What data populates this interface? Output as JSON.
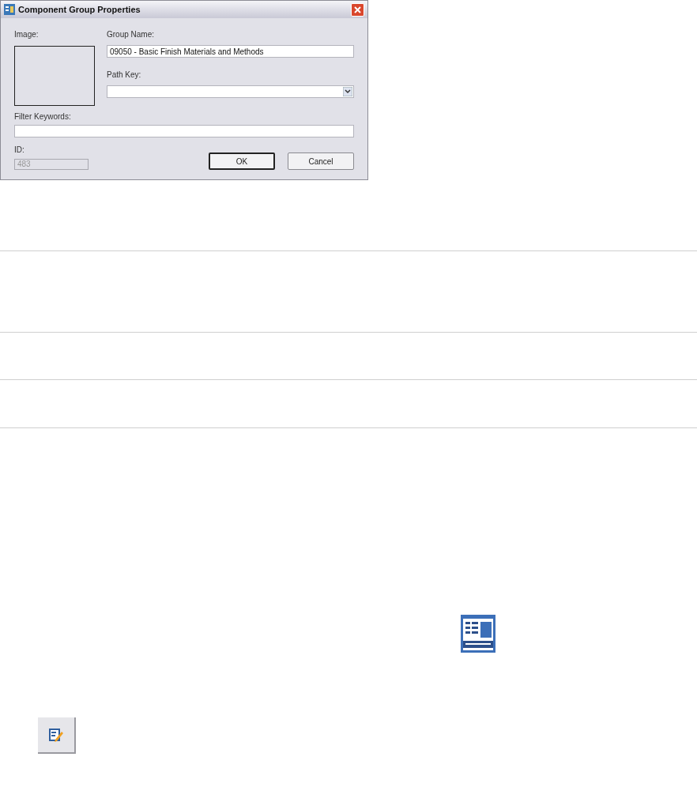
{
  "window": {
    "title": "Component Group Properties"
  },
  "image": {
    "label": "Image:"
  },
  "group_name": {
    "label": "Group Name:",
    "value": "09050 - Basic Finish Materials and Methods"
  },
  "path_key": {
    "label": "Path Key:"
  },
  "filter_keywords": {
    "label": "Filter Keywords:"
  },
  "id": {
    "label": "ID:",
    "value": "483",
    "disabled": true
  },
  "buttons": [
    {
      "label": "OK",
      "default": true
    },
    {
      "label": "Cancel",
      "default": false
    }
  ]
}
